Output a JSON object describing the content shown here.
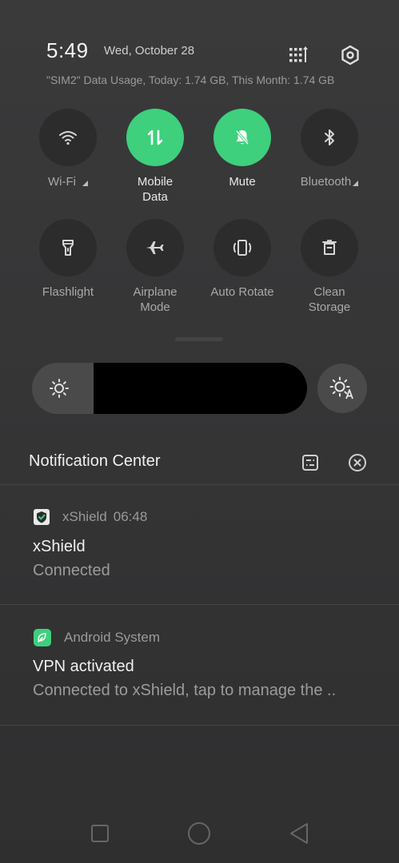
{
  "header": {
    "time": "5:49",
    "date": "Wed, October 28",
    "data_usage": "\"SIM2\" Data Usage, Today: 1.74 GB, This Month: 1.74 GB",
    "edit_icon": "grid-edit-icon",
    "settings_icon": "settings-icon"
  },
  "tiles": [
    {
      "label": "Wi-Fi",
      "icon": "wifi-icon",
      "active": false
    },
    {
      "label": "Mobile\nData",
      "icon": "mobile-data-icon",
      "active": true
    },
    {
      "label": "Mute",
      "icon": "mute-bell-icon",
      "active": true
    },
    {
      "label": "Bluetooth",
      "icon": "bluetooth-icon",
      "active": false
    },
    {
      "label": "Flashlight",
      "icon": "flashlight-icon",
      "active": false
    },
    {
      "label": "Airplane\nMode",
      "icon": "airplane-icon",
      "active": false
    },
    {
      "label": "Auto Rotate",
      "icon": "auto-rotate-icon",
      "active": false
    },
    {
      "label": "Clean\nStorage",
      "icon": "clean-storage-icon",
      "active": false
    }
  ],
  "tile_labels": {
    "wifi": "Wi-Fi",
    "mobile_data_1": "Mobile",
    "mobile_data_2": "Data",
    "mute": "Mute",
    "bluetooth": "Bluetooth",
    "flashlight": "Flashlight",
    "airplane_1": "Airplane",
    "airplane_2": "Mode",
    "auto_rotate": "Auto Rotate",
    "clean_1": "Clean",
    "clean_2": "Storage"
  },
  "brightness": {
    "icon": "brightness-icon",
    "auto_icon": "auto-brightness-icon"
  },
  "notification_center": {
    "title": "Notification Center",
    "manage_icon": "notification-settings-icon",
    "clear_icon": "clear-all-icon"
  },
  "notifications": [
    {
      "app": "xShield",
      "time": "06:48",
      "title": "xShield",
      "body": "Connected",
      "icon": "xshield-app-icon"
    },
    {
      "app": "Android System",
      "title": "VPN activated",
      "body": "Connected to xShield, tap to manage the ..",
      "icon": "android-system-icon"
    }
  ],
  "navbar": {
    "recents_icon": "recents-square-icon",
    "home_icon": "home-circle-icon",
    "back_icon": "back-triangle-icon"
  },
  "colors": {
    "accent": "#3ed07c",
    "background": "#353536",
    "tile_off": "#2c2c2d"
  }
}
